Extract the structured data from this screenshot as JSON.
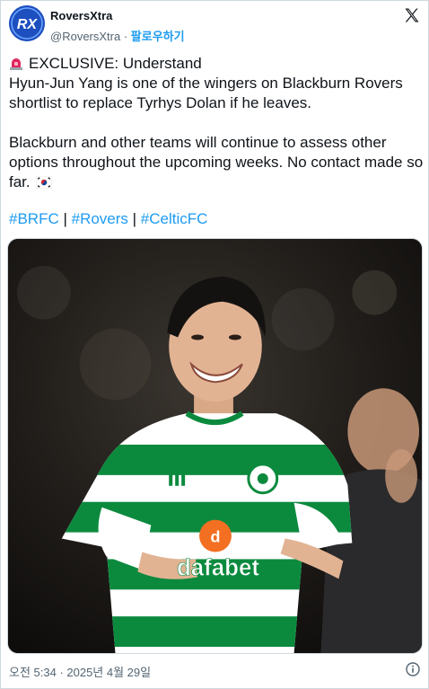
{
  "account": {
    "display_name": "RoversXtra",
    "handle": "@RoversXtra",
    "separator": " · ",
    "follow_label": "팔로우하기",
    "avatar_text": "RX"
  },
  "tweet": {
    "headline": "EXCLUSIVE: Understand",
    "line1": "Hyun-Jun Yang is one of the wingers on Blackburn Rovers shortlist to replace Tyrhys Dolan if he leaves.",
    "line2": "Blackburn and other teams will continue to assess other options throughout the upcoming weeks. No contact made so far.",
    "hashtags": [
      "#BRFC",
      "#Rovers",
      "#CelticFC"
    ],
    "hashtag_separator": " | ",
    "timestamp": "오전 5:34 · 2025년 4월 29일"
  },
  "photo": {
    "sponsor_text": "dafabet",
    "sponsor_brand_color": "#f36f21",
    "kit_green": "#0b8a3e"
  },
  "colors": {
    "accent": "#1d9bf0",
    "muted": "#536471",
    "text": "#0f1419",
    "avatar_bg": "#1d4fbf"
  },
  "icons": [
    "siren-icon",
    "x-logo-icon",
    "korea-flag-icon",
    "info-icon"
  ]
}
